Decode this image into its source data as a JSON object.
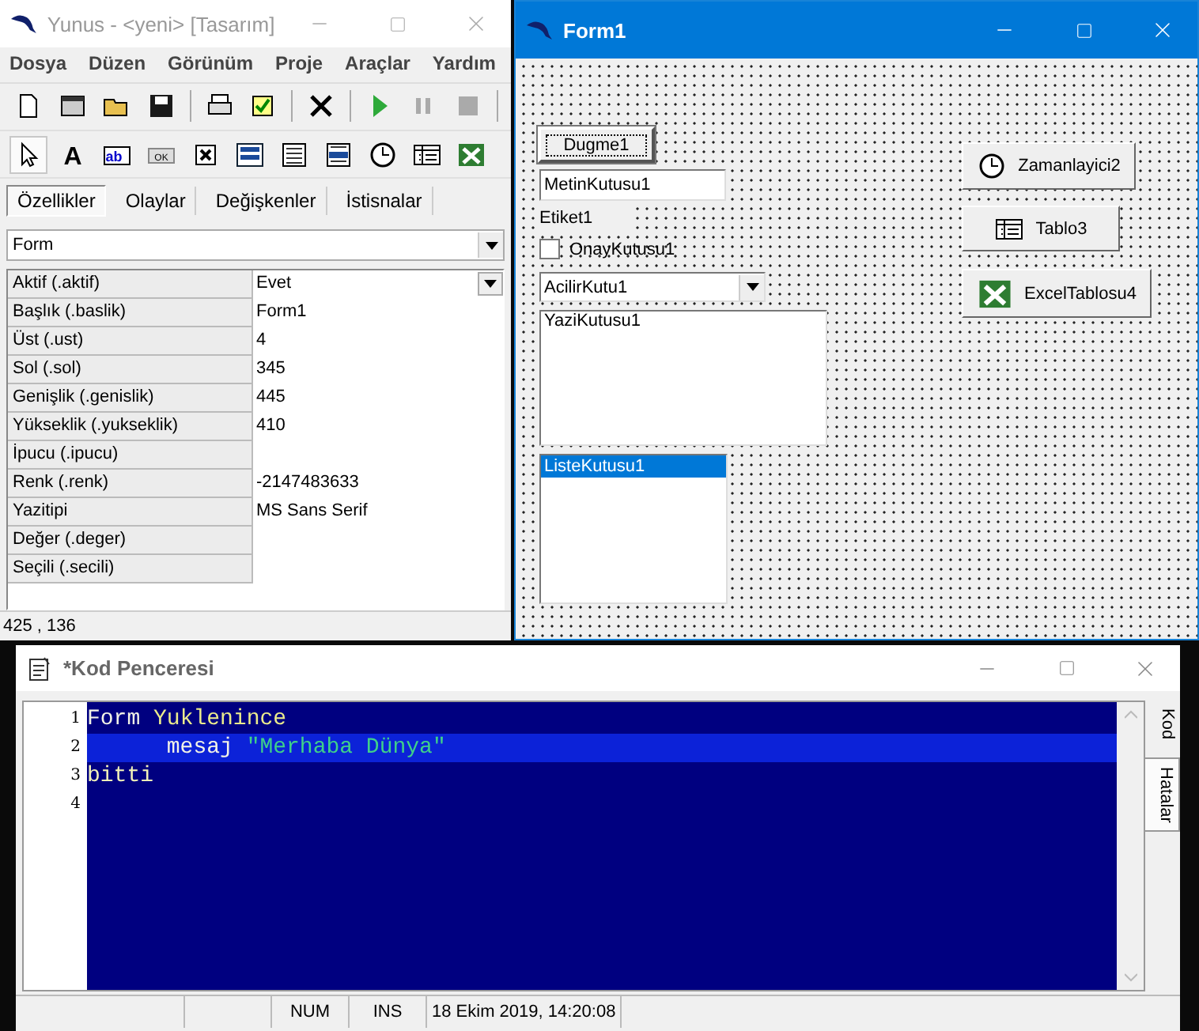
{
  "ide": {
    "title": "Yunus - <yeni> [Tasarım]",
    "menu": [
      "Dosya",
      "Düzen",
      "Görünüm",
      "Proje",
      "Araçlar",
      "Yardım"
    ],
    "palette": [
      {
        "kind": "pointer",
        "selected": true
      },
      {
        "kind": "label",
        "glyph": "A",
        "selected": false
      },
      {
        "kind": "textbox",
        "glyph": "ab",
        "selected": false
      },
      {
        "kind": "button",
        "glyph": "OK",
        "selected": false
      },
      {
        "kind": "checkbox",
        "selected": false
      },
      {
        "kind": "combobox",
        "selected": false
      },
      {
        "kind": "memo",
        "selected": false
      },
      {
        "kind": "listbox",
        "selected": false
      },
      {
        "kind": "timer",
        "selected": false
      },
      {
        "kind": "table",
        "selected": false
      },
      {
        "kind": "excel",
        "selected": false
      }
    ],
    "tabs": [
      {
        "label": "Özellikler",
        "selected": true
      },
      {
        "label": "Olaylar",
        "selected": false
      },
      {
        "label": "Değişkenler",
        "selected": false
      },
      {
        "label": "İstisnalar",
        "selected": false
      }
    ],
    "object_select": "Form",
    "properties": [
      {
        "name": "Aktif (.aktif)",
        "value": "Evet",
        "dropdown": true
      },
      {
        "name": "Başlık (.baslik)",
        "value": "Form1"
      },
      {
        "name": "Üst (.ust)",
        "value": "4"
      },
      {
        "name": "Sol (.sol)",
        "value": "345"
      },
      {
        "name": "Genişlik (.genislik)",
        "value": "445"
      },
      {
        "name": "Yükseklik (.yukseklik)",
        "value": "410"
      },
      {
        "name": "İpucu (.ipucu)"
      },
      {
        "name": "Renk (.renk)",
        "value": "-2147483633"
      },
      {
        "name": "Yazitipi",
        "value": "MS Sans Serif"
      },
      {
        "name": "Değer (.deger)"
      },
      {
        "name": "Seçili (.secili)"
      }
    ],
    "status": "425 , 136"
  },
  "form_window": {
    "title": "Form1",
    "controls": [
      {
        "kind": "button",
        "text": "Dugme1",
        "focused": true
      },
      {
        "kind": "textbox",
        "text": "MetinKutusu1"
      },
      {
        "kind": "label",
        "text": "Etiket1"
      },
      {
        "kind": "checkbox",
        "text": "OnayKutusu1",
        "checked": false
      },
      {
        "kind": "combobox",
        "text": "AcilirKutu1"
      },
      {
        "kind": "memo",
        "text": "YaziKutusu1"
      },
      {
        "kind": "listbox",
        "items": [
          {
            "text": "ListeKutusu1",
            "selected": true
          }
        ]
      },
      {
        "kind": "timer",
        "text": "Zamanlayici2"
      },
      {
        "kind": "table",
        "text": "Tablo3"
      },
      {
        "kind": "excel",
        "text": "ExcelTablosu4"
      }
    ]
  },
  "code_window": {
    "title": "*Kod Penceresi",
    "lines": [
      {
        "number": "1",
        "current": false,
        "tokens": [
          {
            "kind": "keyword",
            "text": "Form"
          },
          {
            "kind": "name",
            "text": " Yuklenince"
          }
        ]
      },
      {
        "number": "2",
        "current": true,
        "tokens": [
          {
            "kind": "keyword",
            "text": "      mesaj"
          },
          {
            "kind": "string",
            "text": " \"Merhaba Dünya\""
          }
        ]
      },
      {
        "number": "3",
        "current": false,
        "tokens": [
          {
            "kind": "end",
            "text": "bitti"
          }
        ]
      },
      {
        "number": "4",
        "current": false
      }
    ],
    "side_tabs": [
      {
        "label": "Kod",
        "selected": true
      },
      {
        "label": "Hatalar",
        "selected": false
      }
    ],
    "status_bar": [
      "NUM",
      "INS",
      "18 Ekim 2019, 14:20:08"
    ]
  }
}
